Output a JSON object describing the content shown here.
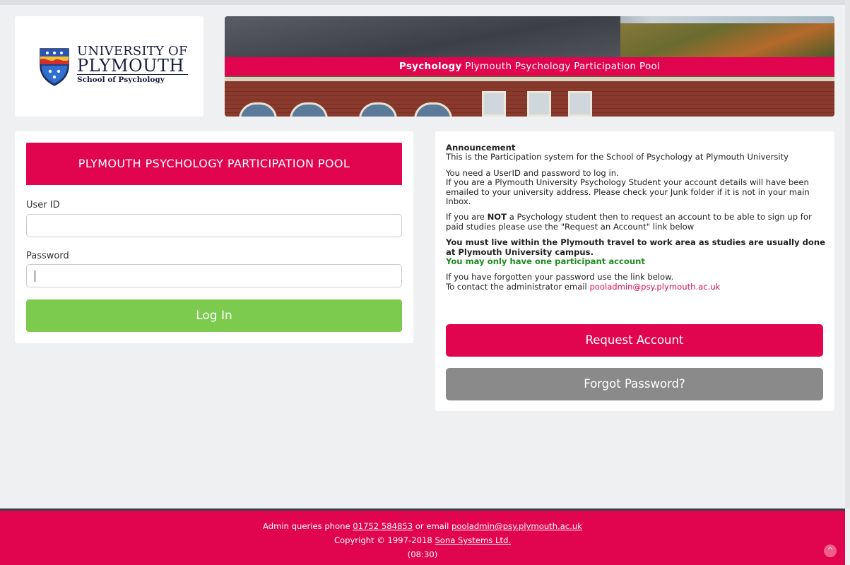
{
  "header": {
    "logo": {
      "line1": "UNIVERSITY OF",
      "line2": "PLYMOUTH",
      "line3": "School of Psychology"
    },
    "banner": {
      "bold": "Psychology",
      "title": "Plymouth Psychology Participation Pool"
    }
  },
  "login": {
    "heading": "PLYMOUTH PSYCHOLOGY PARTICIPATION POOL",
    "userid_label": "User ID",
    "userid_value": "",
    "password_label": "Password",
    "password_value": "",
    "login_button": "Log In"
  },
  "announcement": {
    "title": "Announcement",
    "intro": "This is the Participation system for the School of Psychology at Plymouth University",
    "para2_line1": "You need a UserID and password to log in.",
    "para2_line2": "If you are a Plymouth University Psychology Student your account details will have been emailed to your university address. Please check your Junk folder if it is not in your main Inbox.",
    "para3_pre": "If you are ",
    "para3_bold": "NOT",
    "para3_post": " a Psychology student then to request an account to be able to sign up for paid studies please use the \"Request an Account\" link below",
    "para4_bold": "You must live within the Plymouth travel to work area as studies are usually done at Plymouth University campus.",
    "para4_green": "You may only have one participant account",
    "para5_line1": "If you have forgotten your password use the link below.",
    "para5_line2_pre": "To contact the administrator email ",
    "admin_email": "pooladmin@psy.plymouth.ac.uk",
    "request_button": "Request Account",
    "forgot_button": "Forgot Password?"
  },
  "footer": {
    "l1_pre": "Admin queries phone ",
    "phone": "01752 584853",
    "l1_mid": " or email ",
    "email": "pooladmin@psy.plymouth.ac.uk",
    "l2_pre": "Copyright © 1997-2018 ",
    "company": "Sona Systems Ltd.",
    "time": "(08:30)"
  },
  "colors": {
    "accent": "#e0054e",
    "login_green": "#7ccb4e",
    "forgot_grey": "#8b8a8a",
    "notice_green": "#1d8a1d"
  },
  "icons": [
    "university-crest-icon",
    "scroll-to-top-icon"
  ]
}
